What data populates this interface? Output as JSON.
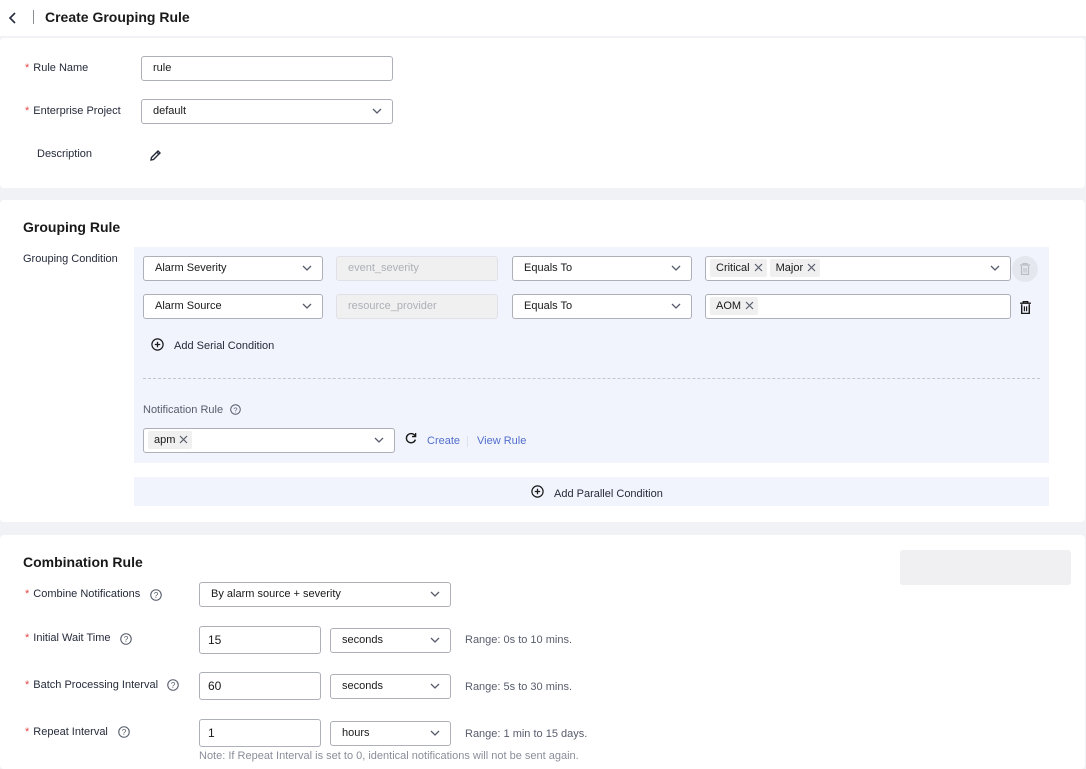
{
  "header": {
    "title": "Create Grouping Rule"
  },
  "basic": {
    "rule_name_label": "Rule Name",
    "rule_name_value": "rule",
    "enterprise_label": "Enterprise Project",
    "enterprise_value": "default",
    "description_label": "Description"
  },
  "grouping": {
    "title": "Grouping Rule",
    "condition_label": "Grouping Condition",
    "rows": [
      {
        "field": "Alarm Severity",
        "key": "event_severity",
        "operator": "Equals To",
        "values": [
          "Critical",
          "Major"
        ]
      },
      {
        "field": "Alarm Source",
        "key": "resource_provider",
        "operator": "Equals To",
        "values": [
          "AOM"
        ]
      }
    ],
    "add_serial": "Add Serial Condition",
    "notification_label": "Notification Rule",
    "notification_value": "apm",
    "create_link": "Create",
    "view_link": "View Rule",
    "add_parallel": "Add Parallel Condition"
  },
  "combination": {
    "title": "Combination Rule",
    "combine_label": "Combine Notifications",
    "combine_value": "By alarm source + severity",
    "initial_wait_label": "Initial Wait Time",
    "initial_wait_value": "15",
    "initial_wait_unit": "seconds",
    "initial_wait_range": "Range: 0s to 10 mins.",
    "batch_label": "Batch Processing Interval",
    "batch_value": "60",
    "batch_unit": "seconds",
    "batch_range": "Range: 5s to 30 mins.",
    "repeat_label": "Repeat Interval",
    "repeat_value": "1",
    "repeat_unit": "hours",
    "repeat_range": "Range: 1 min to 15 days.",
    "repeat_note": "Note: If Repeat Interval is set to 0, identical notifications will not be sent again."
  },
  "colors": {
    "accent": "#526ecc",
    "required": "#e54545",
    "panel": "#f1f4fc"
  }
}
